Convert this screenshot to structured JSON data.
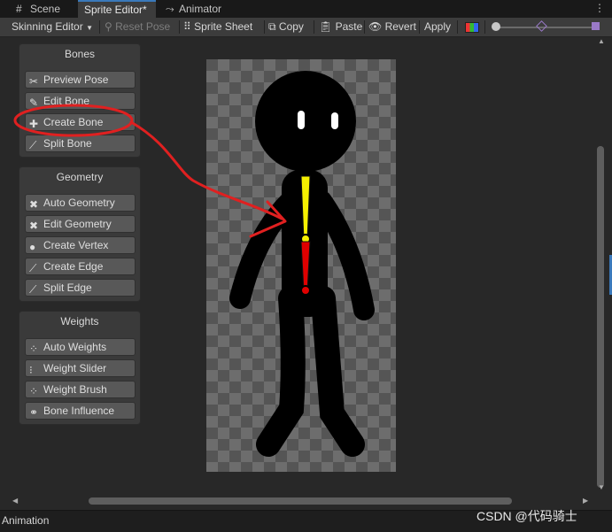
{
  "tabs": [
    {
      "label": "Scene",
      "icon": "grid-icon"
    },
    {
      "label": "Sprite Editor*",
      "icon": ""
    },
    {
      "label": "Animator",
      "icon": "animator-icon"
    }
  ],
  "toolbar": {
    "mode_dropdown": "Skinning Editor",
    "reset_pose": "Reset Pose",
    "sprite_sheet": "Sprite Sheet",
    "copy": "Copy",
    "paste": "Paste",
    "revert": "Revert",
    "apply": "Apply"
  },
  "panels": {
    "bones": {
      "title": "Bones",
      "buttons": [
        "Preview Pose",
        "Edit Bone",
        "Create Bone",
        "Split Bone"
      ]
    },
    "geometry": {
      "title": "Geometry",
      "buttons": [
        "Auto Geometry",
        "Edit Geometry",
        "Create Vertex",
        "Create Edge",
        "Split Edge"
      ]
    },
    "weights": {
      "title": "Weights",
      "buttons": [
        "Auto Weights",
        "Weight Slider",
        "Weight Brush",
        "Bone Influence"
      ]
    }
  },
  "status_bar": {
    "label": "Animation",
    "watermark": "CSDN @代码骑士"
  },
  "colors": {
    "accent": "#3a79bb",
    "bone_yellow": "#f5f000",
    "bone_red": "#e00000",
    "annotation_red": "#e02020"
  }
}
